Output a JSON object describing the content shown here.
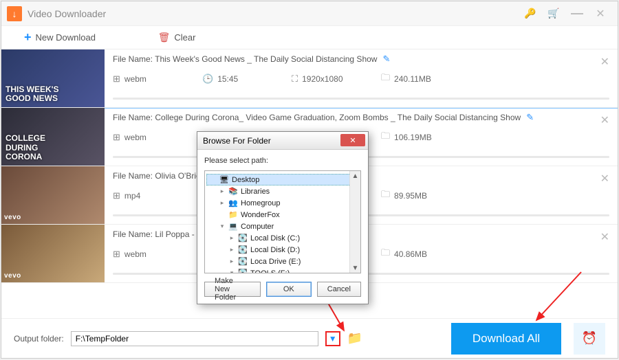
{
  "app": {
    "title": "Video Downloader"
  },
  "toolbar": {
    "new": "New Download",
    "clear": "Clear"
  },
  "items": [
    {
      "filename_label": "File Name: This Week's Good News _ The Daily Social Distancing Show",
      "format": "webm",
      "duration": "15:45",
      "resolution": "1920x1080",
      "size": "240.11MB",
      "thumb_text": "THIS WEEK'S\nGOOD NEWS",
      "selected": true
    },
    {
      "filename_label": "File Name: College During Corona_ Video Game Graduation, Zoom Bombs _ The Daily Social Distancing Show",
      "format": "webm",
      "duration": "",
      "resolution": "",
      "size": "106.19MB",
      "thumb_text": "COLLEGE\nDURING\nCORONA",
      "selected": false
    },
    {
      "filename_label": "File Name: Olivia O'Brie",
      "format": "mp4",
      "duration": "",
      "resolution": "",
      "size": "89.95MB",
      "thumb_text": "",
      "vevo": true,
      "selected": false
    },
    {
      "filename_label": "File Name: Lil Poppa - T",
      "format": "webm",
      "duration": "",
      "resolution": "",
      "size": "40.86MB",
      "thumb_text": "",
      "vevo": true,
      "selected": false
    }
  ],
  "footer": {
    "label": "Output folder:",
    "path": "F:\\TempFolder",
    "download_all": "Download All"
  },
  "dialog": {
    "title": "Browse For Folder",
    "msg": "Please select path:",
    "tree": [
      {
        "label": "Desktop",
        "indent": 0,
        "twist": "",
        "icon": "🖥",
        "selected": true
      },
      {
        "label": "Libraries",
        "indent": 1,
        "twist": "▸",
        "icon": "📚"
      },
      {
        "label": "Homegroup",
        "indent": 1,
        "twist": "▸",
        "icon": "👥"
      },
      {
        "label": "WonderFox",
        "indent": 1,
        "twist": "",
        "icon": "📁"
      },
      {
        "label": "Computer",
        "indent": 1,
        "twist": "▾",
        "icon": "💻"
      },
      {
        "label": "Local Disk (C:)",
        "indent": 2,
        "twist": "▸",
        "icon": "💽"
      },
      {
        "label": "Local Disk (D:)",
        "indent": 2,
        "twist": "▸",
        "icon": "💽"
      },
      {
        "label": "Loca Drive (E:)",
        "indent": 2,
        "twist": "▸",
        "icon": "💽"
      },
      {
        "label": "TOOLS (F:)",
        "indent": 2,
        "twist": "▾",
        "icon": "💽"
      }
    ],
    "make": "Make New Folder",
    "ok": "OK",
    "cancel": "Cancel"
  }
}
